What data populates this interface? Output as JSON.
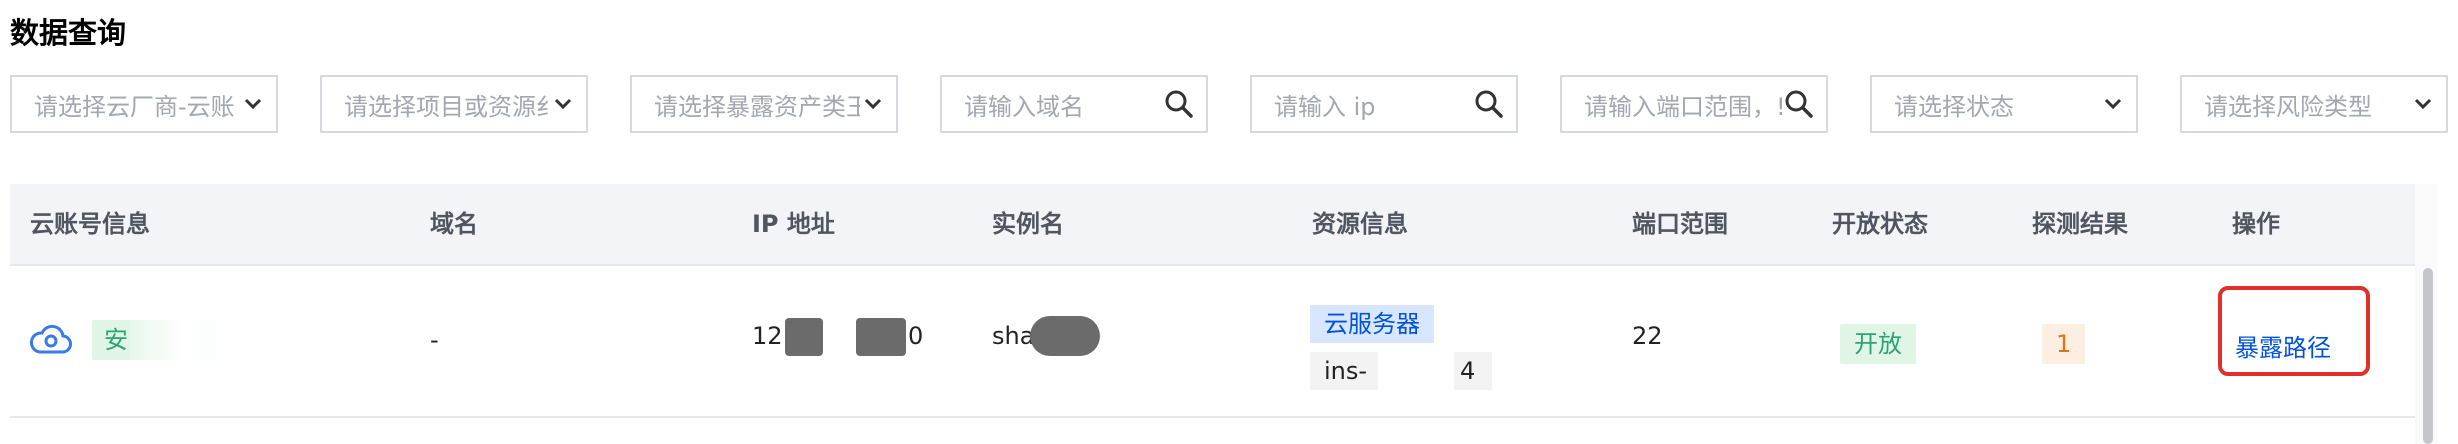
{
  "page": {
    "title": "数据查询"
  },
  "filters": [
    {
      "type": "select",
      "placeholder": "请选择云厂商-云账",
      "icon": "chevron-down-icon"
    },
    {
      "type": "select",
      "placeholder": "请选择项目或资源纟",
      "icon": "chevron-down-icon"
    },
    {
      "type": "select",
      "placeholder": "请选择暴露资产类王",
      "icon": "chevron-down-icon"
    },
    {
      "type": "search",
      "placeholder": "请输入域名",
      "icon": "search-icon"
    },
    {
      "type": "search",
      "placeholder": "请输入 ip",
      "icon": "search-icon"
    },
    {
      "type": "search",
      "placeholder": "请输入端口范围，!",
      "icon": "search-icon"
    },
    {
      "type": "select",
      "placeholder": "请选择状态",
      "icon": "chevron-down-icon"
    },
    {
      "type": "select",
      "placeholder": "请选择风险类型",
      "icon": "chevron-down-icon"
    }
  ],
  "table": {
    "columns": [
      "云账号信息",
      "域名",
      "IP 地址",
      "实例名",
      "资源信息",
      "端口范围",
      "开放状态",
      "探测结果",
      "操作"
    ],
    "rows": [
      {
        "account": {
          "icon": "cloud-icon",
          "tag": "安"
        },
        "domain": "-",
        "ip": {
          "prefix": "12",
          "suffix": "0"
        },
        "instance": "sha",
        "resource": {
          "type_tag": "云服务器",
          "instance_id_prefix": "ins-",
          "instance_id_suffix": "4"
        },
        "ports": "22",
        "status": "开放",
        "result": "1",
        "action": "暴露路径"
      }
    ]
  },
  "colors": {
    "accent_blue": "#0052d9",
    "success_green": "#2ba471",
    "warning_orange": "#e37318",
    "highlight_red": "#e0302c"
  }
}
